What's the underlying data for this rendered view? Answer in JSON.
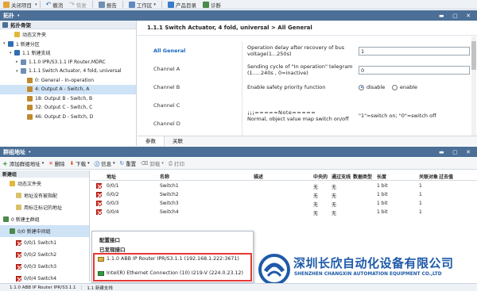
{
  "toolbar": {
    "close_project": "关闭项目",
    "undo": "撤消",
    "redo": "恢复",
    "report": "报告",
    "workspace": "工作区",
    "product_catalog": "产品目录",
    "diagnostics": "诊断"
  },
  "topology": {
    "title": "拓扑",
    "subheader": "拓扑骨架",
    "tree": [
      {
        "label": "动态文件夹",
        "indent": 1,
        "icon": "folder-icon",
        "expand": ""
      },
      {
        "label": "1 新建分区",
        "indent": 0,
        "icon": "area-icon",
        "expand": "▾"
      },
      {
        "label": "1.1 新建支线",
        "indent": 1,
        "icon": "line-icon",
        "expand": "▾"
      },
      {
        "label": "1.1.0 IPR/S3.1.1 IP Router,MDRC",
        "indent": 2,
        "icon": "device-icon",
        "expand": "▸"
      },
      {
        "label": "1.1.1 Switch Actuator, 4 fold, universal",
        "indent": 2,
        "icon": "device-icon",
        "expand": "▾"
      },
      {
        "label": "0: General - In-operation",
        "indent": 3,
        "icon": "object-icon",
        "expand": ""
      },
      {
        "label": "4: Output A - Switch, A",
        "indent": 3,
        "icon": "object-icon",
        "expand": "",
        "selected": true
      },
      {
        "label": "18: Output B - Switch, B",
        "indent": 3,
        "icon": "object-icon",
        "expand": ""
      },
      {
        "label": "32: Output C - Switch, C",
        "indent": 3,
        "icon": "object-icon",
        "expand": ""
      },
      {
        "label": "46: Output D - Switch, D",
        "indent": 3,
        "icon": "object-icon",
        "expand": ""
      }
    ]
  },
  "device": {
    "title": "1.1.1 Switch Actuator, 4 fold, universal > All General",
    "channels": [
      "All General",
      "Channel A",
      "Channel B",
      "Channel C",
      "Channel D"
    ],
    "params": {
      "delay_label": "Operation delay after recovery of bus voltage(1...250s)",
      "delay_value": "1",
      "cycle_label": "Sending cycle of \"In operation\" telegram (1.....240s , 0=inactive)",
      "cycle_value": "0",
      "safety_label": "Enable safety priority function",
      "disable": "disable",
      "enable": "enable",
      "note_title": "¡¡¡=====Note=====",
      "note_text": "Normal, object value map switch on/off",
      "note_value": "\"1\"=switch on; \"0\"=switch off"
    },
    "tabs": [
      "参数",
      "关联"
    ]
  },
  "group": {
    "title": "群组地址",
    "toolbar": {
      "add": "添加群组地址",
      "delete": "删除",
      "download": "下载",
      "info": "信息",
      "reset": "重置",
      "unload": "卸载",
      "print": "打印"
    },
    "tree_header": "新建组",
    "tree": [
      {
        "label": "动态文件夹",
        "indent": 1
      },
      {
        "label": "地址没有被指配",
        "indent": 2
      },
      {
        "label": "用标注标记的地址",
        "indent": 2
      },
      {
        "label": "0 新建主群组",
        "indent": 0
      },
      {
        "label": "0/0 新建中间组",
        "indent": 1,
        "selected": true
      },
      {
        "label": "0/0/1 Switch1",
        "indent": 2
      },
      {
        "label": "0/0/2 Switch2",
        "indent": 2
      },
      {
        "label": "0/0/3 Switch3",
        "indent": 2
      },
      {
        "label": "0/0/4 Switch4",
        "indent": 2
      }
    ],
    "columns": [
      "地址",
      "名称",
      "描述",
      "中央的",
      "通过支线",
      "数据类型",
      "长度",
      "关联对象",
      "过去值"
    ],
    "rows": [
      {
        "address": "0/0/1",
        "name": "Switch1",
        "central": "无",
        "pass": "无",
        "length": "1 bit",
        "assoc": "1"
      },
      {
        "address": "0/0/2",
        "name": "Switch2",
        "central": "无",
        "pass": "无",
        "length": "1 bit",
        "assoc": "1"
      },
      {
        "address": "0/0/3",
        "name": "Switch3",
        "central": "无",
        "pass": "无",
        "length": "1 bit",
        "assoc": "1"
      },
      {
        "address": "0/0/4",
        "name": "Switch4",
        "central": "无",
        "pass": "无",
        "length": "1 bit",
        "assoc": "1"
      }
    ]
  },
  "popup": {
    "configured": "配置接口",
    "discovered": "已发现接口",
    "interfaces": [
      "1.1.0 ABB IP Router IPR/S3.1.1 (192.168.1.222:3671)",
      "Intel(R) Ethernet Connection (10) I219-V (224.0.23.12)"
    ]
  },
  "statusbar": {
    "left": "1.1.0 ABB IP Router IPR/S3.1.1",
    "line": "1.1 新建支线"
  },
  "watermark": {
    "cn": "深圳长欣自动化设备有限公司",
    "en": "SHENZHEN CHANGXIN AUTOMATION EQUIPMENT CO.,LTD"
  },
  "colors": {
    "header_blue": "#4b6f96",
    "selected_row": "#cfe3f7",
    "highlight_box": "#e53935",
    "logo_blue": "#1e5aa8"
  }
}
